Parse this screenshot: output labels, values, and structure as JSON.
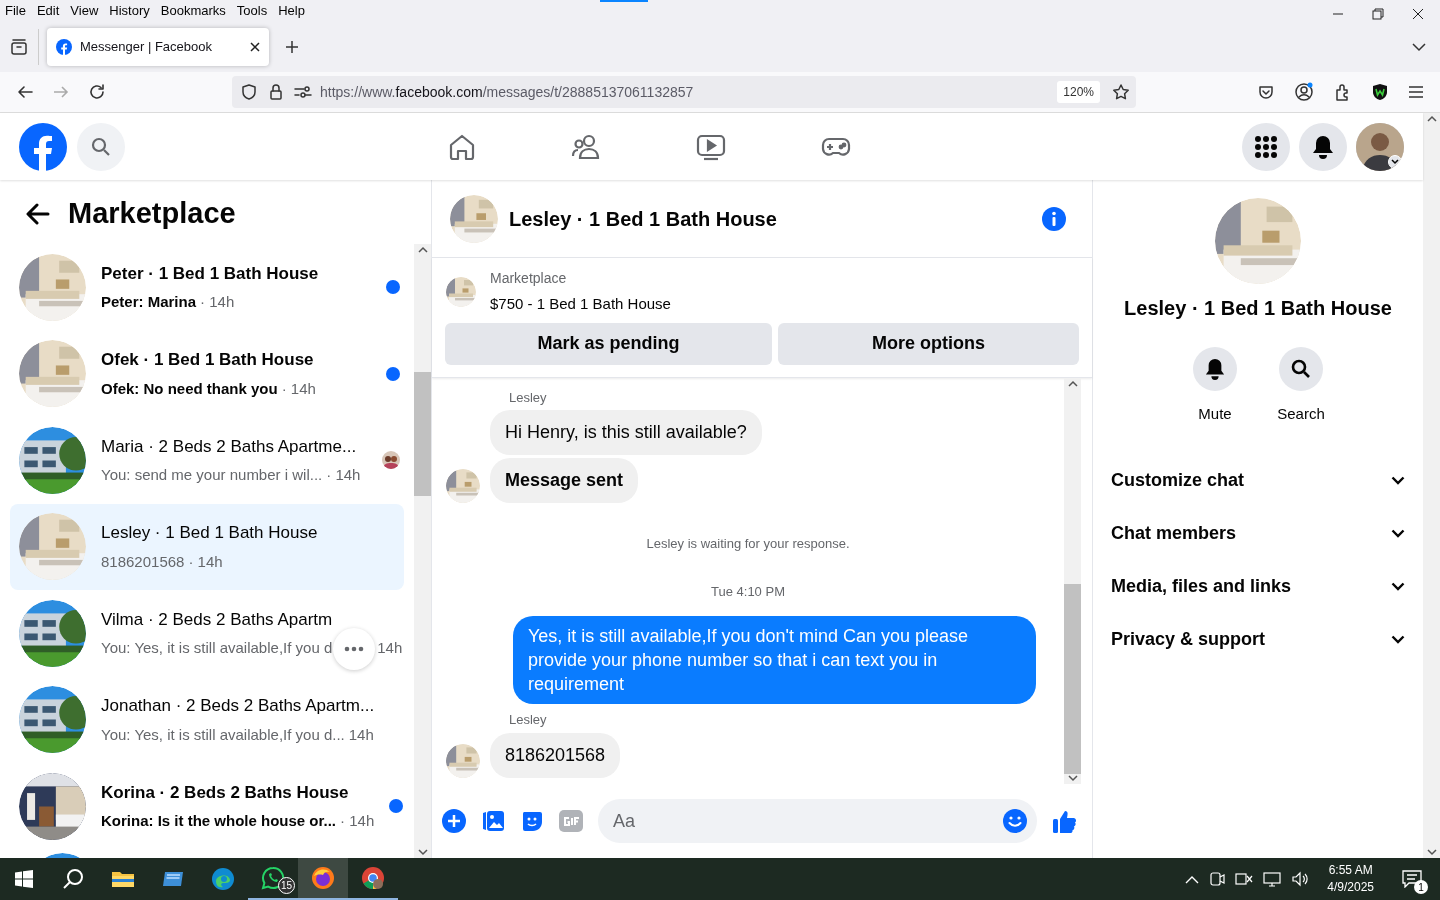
{
  "browser": {
    "menu": [
      "File",
      "Edit",
      "View",
      "History",
      "Bookmarks",
      "Tools",
      "Help"
    ],
    "tab": {
      "title": "Messenger | Facebook",
      "selected": true
    },
    "url": {
      "prefix": "https://www.",
      "domain": "facebook.com",
      "path": "/messages/t/28885137061132857"
    },
    "zoom": "120%"
  },
  "left_pane": {
    "title": "Marketplace",
    "conversations": [
      {
        "title": "Peter · 1 Bed 1 Bath House",
        "preview": "Peter: Marina",
        "time": "· 14h",
        "unread": true,
        "selected": false,
        "seen_avatar": false,
        "more_button": false
      },
      {
        "title": "Ofek · 1 Bed 1 Bath House",
        "preview": "Ofek: No need thank you",
        "time": "· 14h",
        "unread": true,
        "selected": false,
        "seen_avatar": false,
        "more_button": false
      },
      {
        "title": "Maria · 2 Beds 2 Baths Apartme...",
        "preview": "You: send me your number i wil...",
        "time": "· 14h",
        "unread": false,
        "selected": false,
        "seen_avatar": true,
        "more_button": false
      },
      {
        "title": "Lesley · 1 Bed 1 Bath House",
        "preview": "8186201568",
        "time": "· 14h",
        "unread": false,
        "selected": true,
        "seen_avatar": false,
        "more_button": false
      },
      {
        "title": "Vilma · 2 Beds 2 Baths Apartm",
        "preview": "You: Yes, it is still available,If you d",
        "time": "14h",
        "unread": false,
        "selected": false,
        "seen_avatar": false,
        "more_button": true
      },
      {
        "title": "Jonathan · 2 Beds 2 Baths Apartm...",
        "preview": "You: Yes, it is still available,If you d...",
        "time": "14h",
        "unread": false,
        "selected": false,
        "seen_avatar": false,
        "more_button": false
      },
      {
        "title": "Korina · 2 Beds 2 Baths House",
        "preview": "Korina: Is it the whole house or...",
        "time": "· 14h",
        "unread": true,
        "selected": false,
        "seen_avatar": false,
        "more_button": false
      }
    ]
  },
  "chat": {
    "title": "Lesley · 1 Bed 1 Bath House",
    "listing": {
      "source": "Marketplace",
      "title": "$750 - 1 Bed 1 Bath House",
      "buttons": [
        "Mark as pending",
        "More options"
      ]
    },
    "messages": [
      {
        "kind": "sender",
        "text": "Lesley"
      },
      {
        "kind": "incoming",
        "text": "Hi Henry, is this still available?",
        "avatar": false,
        "bold": false
      },
      {
        "kind": "incoming",
        "text": "Message sent",
        "avatar": true,
        "bold": true
      },
      {
        "kind": "status",
        "text": "Lesley is waiting for your response."
      },
      {
        "kind": "timestamp",
        "text": "Tue 4:10 PM"
      },
      {
        "kind": "outgoing",
        "text": "Yes, it is still available,If you don't mind Can you please provide your phone number so that i can text you in requirement"
      },
      {
        "kind": "sender",
        "text": "Lesley"
      },
      {
        "kind": "incoming",
        "text": "8186201568",
        "avatar": true,
        "bold": false
      }
    ],
    "composer": {
      "placeholder": "Aa"
    }
  },
  "info_pane": {
    "name": "Lesley · 1 Bed 1 Bath House",
    "actions": [
      "Mute",
      "Search"
    ],
    "sections": [
      {
        "label": "Customize chat",
        "expanded": false
      },
      {
        "label": "Chat members",
        "expanded": false
      },
      {
        "label": "Media, files and links",
        "expanded": false
      },
      {
        "label": "Privacy & support",
        "expanded": false
      }
    ]
  },
  "taskbar": {
    "whatsapp_badge": "15",
    "time": "6:55 AM",
    "date": "4/9/2025",
    "notifications": "1"
  }
}
